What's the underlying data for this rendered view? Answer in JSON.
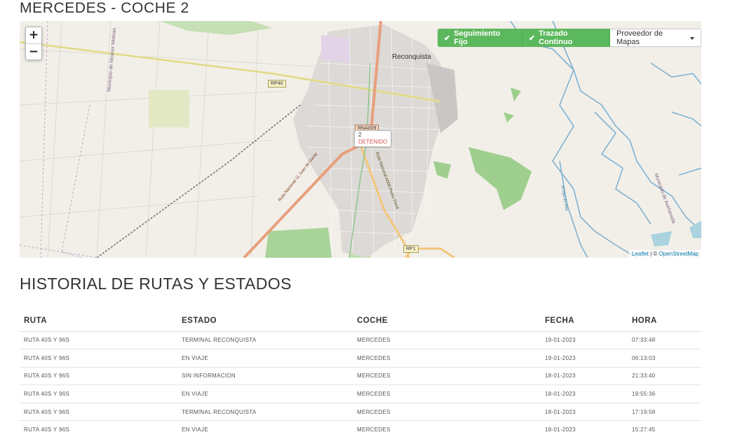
{
  "page_title": "MERCEDES - COCHE 2",
  "map": {
    "zoom_in": "+",
    "zoom_out": "−",
    "toolbar": {
      "follow_label": "Seguimiento Fijo",
      "trace_label": "Trazado Continuo",
      "provider_label": "Proveedor de Mapas"
    },
    "vehicle": {
      "number": "2",
      "status": "DETENIDO"
    },
    "labels": {
      "city": "Reconquista",
      "municipality_left": "Municipio de Nicanor Molinas",
      "municipality_right": "Municipio de Avellaneda",
      "road_rp40": "RP40",
      "road_rp1": "RP1",
      "road_rna009": "RNA009",
      "route_11": "Ruta Nacional 11 Juan de Garay",
      "route_a009": "Ruta Nacional A009 Pedro Ferré",
      "stream": "Arroyo El Rey"
    },
    "attribution": {
      "leaflet": "Leaflet",
      "separator": " | © ",
      "osm": "OpenStreetMap"
    }
  },
  "history": {
    "title": "HISTORIAL DE RUTAS Y ESTADOS",
    "columns": [
      "RUTA",
      "ESTADO",
      "COCHE",
      "FECHA",
      "HORA"
    ],
    "rows": [
      [
        "RUTA 40S Y 96S",
        "TERMINAL RECONQUISTA",
        "MERCEDES",
        "19-01-2023",
        "07:33:48"
      ],
      [
        "RUTA 40S Y 96S",
        "EN VIAJE",
        "MERCEDES",
        "19-01-2023",
        "06:13:03"
      ],
      [
        "RUTA 40S Y 96S",
        "SIN INFORMACION",
        "MERCEDES",
        "18-01-2023",
        "21:33:40"
      ],
      [
        "RUTA 40S Y 96S",
        "EN VIAJE",
        "MERCEDES",
        "18-01-2023",
        "19:55:36"
      ],
      [
        "RUTA 40S Y 96S",
        "TERMINAL RECONQUISTA",
        "MERCEDES",
        "18-01-2023",
        "17:19:58"
      ],
      [
        "RUTA 40S Y 96S",
        "EN VIAJE",
        "MERCEDES",
        "18-01-2023",
        "15:27:45"
      ]
    ]
  },
  "colors": {
    "accent_green": "#5cb85c",
    "status_red": "#d9534f",
    "map_background": "#f2efe9",
    "river": "#7fb3d3"
  }
}
